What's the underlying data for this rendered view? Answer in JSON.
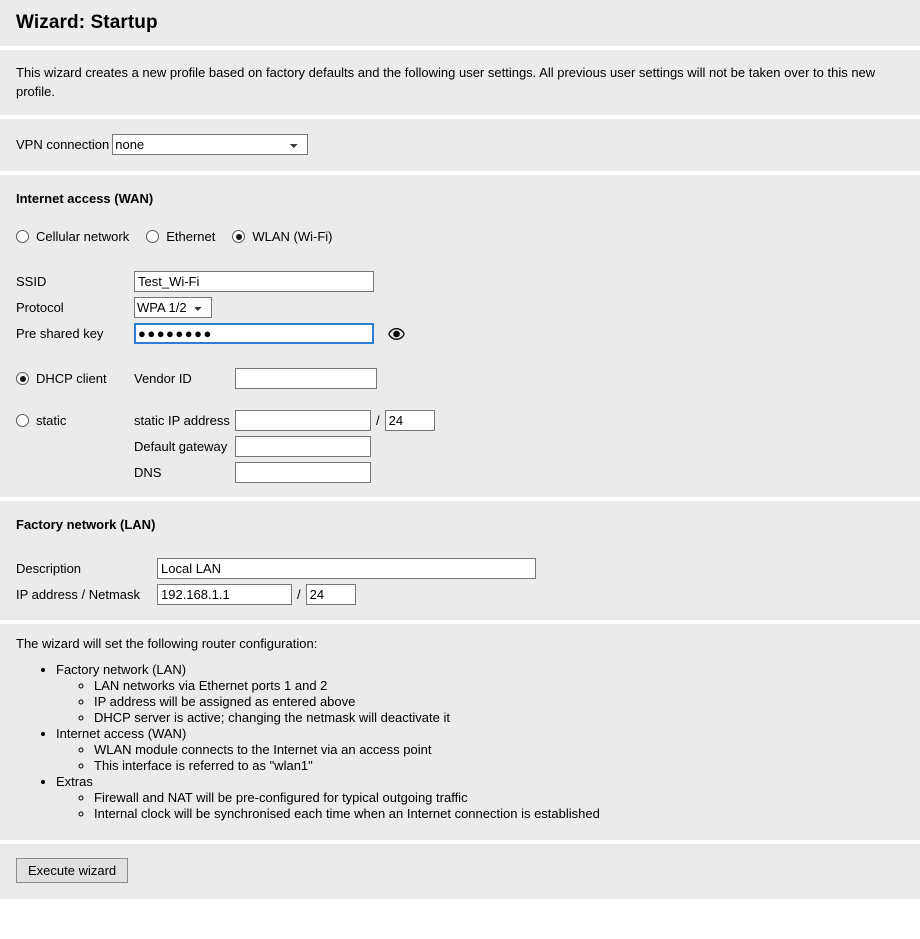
{
  "page": {
    "title": "Wizard: Startup",
    "intro": "This wizard creates a new profile based on factory defaults and the following user settings. All previous user settings will not be taken over to this new profile."
  },
  "vpn": {
    "label": "VPN connection",
    "selected": "none",
    "options": [
      "none"
    ]
  },
  "wan": {
    "heading": "Internet access (WAN)",
    "connection_types": [
      {
        "label": "Cellular network",
        "checked": false
      },
      {
        "label": "Ethernet",
        "checked": false
      },
      {
        "label": "WLAN (Wi-Fi)",
        "checked": true
      }
    ],
    "ssid_label": "SSID",
    "ssid_value": "Test_Wi-Fi",
    "protocol_label": "Protocol",
    "protocol_selected": "WPA 1/2",
    "protocol_options": [
      "WPA 1/2"
    ],
    "psk_label": "Pre shared key",
    "psk_value": "●●●●●●●●",
    "reveal_icon": "eye-icon",
    "dhcp_label": "DHCP client",
    "dhcp_checked": true,
    "vendor_id_label": "Vendor ID",
    "vendor_id_value": "",
    "static_label": "static",
    "static_checked": false,
    "static_ip_label": "static IP address",
    "static_ip_value": "",
    "static_netmask_value": "24",
    "gateway_label": "Default gateway",
    "gateway_value": "",
    "dns_label": "DNS",
    "dns_value": "",
    "slash": "/"
  },
  "lan": {
    "heading": "Factory network (LAN)",
    "description_label": "Description",
    "description_value": "Local LAN",
    "ip_label": "IP address / Netmask",
    "ip_value": "192.168.1.1",
    "netmask_value": "24",
    "slash": "/"
  },
  "summary": {
    "intro": "The wizard will set the following router configuration:",
    "groups": [
      {
        "title": "Factory network (LAN)",
        "items": [
          "LAN networks via Ethernet ports 1 and 2",
          "IP address will be assigned as entered above",
          "DHCP server is active; changing the netmask will deactivate it"
        ]
      },
      {
        "title": "Internet access (WAN)",
        "items": [
          "WLAN module connects to the Internet via an access point",
          "This interface is referred to as \"wlan1\""
        ]
      },
      {
        "title": "Extras",
        "items": [
          "Firewall and NAT will be pre-configured for typical outgoing traffic",
          "Internal clock will be synchronised each time when an Internet connection is established"
        ]
      }
    ]
  },
  "footer": {
    "execute_label": "Execute wizard"
  },
  "colors": {
    "panel_bg": "#ebebeb",
    "separator": "#ffffff",
    "focus_border": "#2a7fd4",
    "field_border": "#767676",
    "button_bg": "#e0e0e0"
  }
}
